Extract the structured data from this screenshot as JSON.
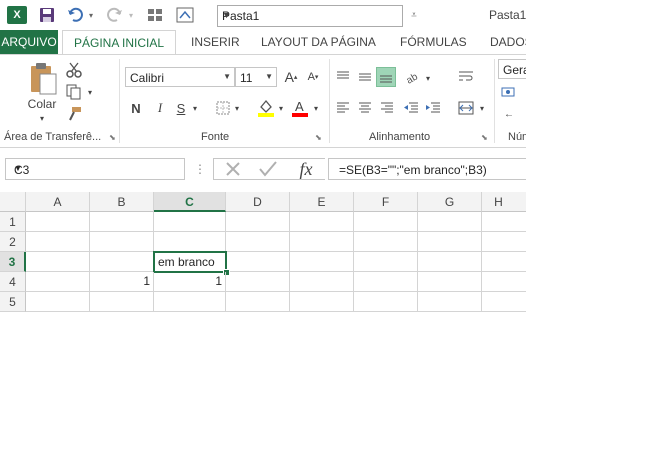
{
  "qat": {
    "app_icon": "X",
    "doc_name": "Pasta1",
    "window_title": "Pasta1"
  },
  "tabs": {
    "file": "ARQUIVO",
    "home": "PÁGINA INICIAL",
    "insert": "INSERIR",
    "page_layout": "LAYOUT DA PÁGINA",
    "formulas": "FÓRMULAS",
    "data": "DADOS"
  },
  "ribbon": {
    "clipboard": {
      "paste_label": "Colar",
      "group_label": "Área de Transferê..."
    },
    "font": {
      "font_name": "Calibri",
      "font_size": "11",
      "bold": "N",
      "italic": "I",
      "underline": "S",
      "group_label": "Fonte"
    },
    "alignment": {
      "group_label": "Alinhamento"
    },
    "number": {
      "format": "Gera",
      "group_label": "Núm"
    }
  },
  "formula_bar": {
    "name_box": "C3",
    "fx": "fx",
    "formula": "=SE(B3=\"\";\"em branco\";B3)"
  },
  "grid": {
    "columns": [
      "A",
      "B",
      "C",
      "D",
      "E",
      "F",
      "G",
      "H"
    ],
    "selected_column": "C",
    "rows": [
      "1",
      "2",
      "3",
      "4",
      "5"
    ],
    "selected_row": "3",
    "cells": {
      "C3": "em branco",
      "B4": "1",
      "C4": "1"
    }
  },
  "colors": {
    "accent": "#217346",
    "highlight_fill": "#ffff00",
    "font_color": "#ff0000"
  }
}
